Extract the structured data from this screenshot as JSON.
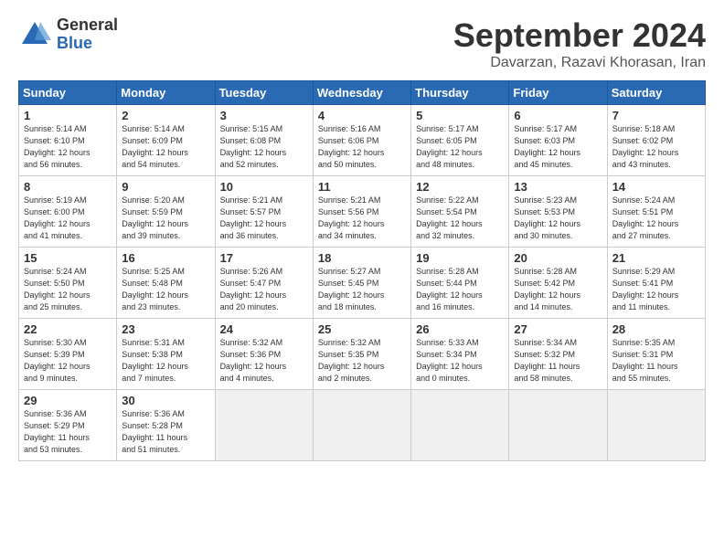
{
  "logo": {
    "general": "General",
    "blue": "Blue"
  },
  "title": "September 2024",
  "location": "Davarzan, Razavi Khorasan, Iran",
  "weekdays": [
    "Sunday",
    "Monday",
    "Tuesday",
    "Wednesday",
    "Thursday",
    "Friday",
    "Saturday"
  ],
  "days": [
    {
      "num": "",
      "info": ""
    },
    {
      "num": "",
      "info": ""
    },
    {
      "num": "",
      "info": ""
    },
    {
      "num": "",
      "info": ""
    },
    {
      "num": "",
      "info": ""
    },
    {
      "num": "",
      "info": ""
    },
    {
      "num": "1",
      "info": "Sunrise: 5:14 AM\nSunset: 6:10 PM\nDaylight: 12 hours\nand 56 minutes."
    },
    {
      "num": "2",
      "info": "Sunrise: 5:14 AM\nSunset: 6:09 PM\nDaylight: 12 hours\nand 54 minutes."
    },
    {
      "num": "3",
      "info": "Sunrise: 5:15 AM\nSunset: 6:08 PM\nDaylight: 12 hours\nand 52 minutes."
    },
    {
      "num": "4",
      "info": "Sunrise: 5:16 AM\nSunset: 6:06 PM\nDaylight: 12 hours\nand 50 minutes."
    },
    {
      "num": "5",
      "info": "Sunrise: 5:17 AM\nSunset: 6:05 PM\nDaylight: 12 hours\nand 48 minutes."
    },
    {
      "num": "6",
      "info": "Sunrise: 5:17 AM\nSunset: 6:03 PM\nDaylight: 12 hours\nand 45 minutes."
    },
    {
      "num": "7",
      "info": "Sunrise: 5:18 AM\nSunset: 6:02 PM\nDaylight: 12 hours\nand 43 minutes."
    },
    {
      "num": "8",
      "info": "Sunrise: 5:19 AM\nSunset: 6:00 PM\nDaylight: 12 hours\nand 41 minutes."
    },
    {
      "num": "9",
      "info": "Sunrise: 5:20 AM\nSunset: 5:59 PM\nDaylight: 12 hours\nand 39 minutes."
    },
    {
      "num": "10",
      "info": "Sunrise: 5:21 AM\nSunset: 5:57 PM\nDaylight: 12 hours\nand 36 minutes."
    },
    {
      "num": "11",
      "info": "Sunrise: 5:21 AM\nSunset: 5:56 PM\nDaylight: 12 hours\nand 34 minutes."
    },
    {
      "num": "12",
      "info": "Sunrise: 5:22 AM\nSunset: 5:54 PM\nDaylight: 12 hours\nand 32 minutes."
    },
    {
      "num": "13",
      "info": "Sunrise: 5:23 AM\nSunset: 5:53 PM\nDaylight: 12 hours\nand 30 minutes."
    },
    {
      "num": "14",
      "info": "Sunrise: 5:24 AM\nSunset: 5:51 PM\nDaylight: 12 hours\nand 27 minutes."
    },
    {
      "num": "15",
      "info": "Sunrise: 5:24 AM\nSunset: 5:50 PM\nDaylight: 12 hours\nand 25 minutes."
    },
    {
      "num": "16",
      "info": "Sunrise: 5:25 AM\nSunset: 5:48 PM\nDaylight: 12 hours\nand 23 minutes."
    },
    {
      "num": "17",
      "info": "Sunrise: 5:26 AM\nSunset: 5:47 PM\nDaylight: 12 hours\nand 20 minutes."
    },
    {
      "num": "18",
      "info": "Sunrise: 5:27 AM\nSunset: 5:45 PM\nDaylight: 12 hours\nand 18 minutes."
    },
    {
      "num": "19",
      "info": "Sunrise: 5:28 AM\nSunset: 5:44 PM\nDaylight: 12 hours\nand 16 minutes."
    },
    {
      "num": "20",
      "info": "Sunrise: 5:28 AM\nSunset: 5:42 PM\nDaylight: 12 hours\nand 14 minutes."
    },
    {
      "num": "21",
      "info": "Sunrise: 5:29 AM\nSunset: 5:41 PM\nDaylight: 12 hours\nand 11 minutes."
    },
    {
      "num": "22",
      "info": "Sunrise: 5:30 AM\nSunset: 5:39 PM\nDaylight: 12 hours\nand 9 minutes."
    },
    {
      "num": "23",
      "info": "Sunrise: 5:31 AM\nSunset: 5:38 PM\nDaylight: 12 hours\nand 7 minutes."
    },
    {
      "num": "24",
      "info": "Sunrise: 5:32 AM\nSunset: 5:36 PM\nDaylight: 12 hours\nand 4 minutes."
    },
    {
      "num": "25",
      "info": "Sunrise: 5:32 AM\nSunset: 5:35 PM\nDaylight: 12 hours\nand 2 minutes."
    },
    {
      "num": "26",
      "info": "Sunrise: 5:33 AM\nSunset: 5:34 PM\nDaylight: 12 hours\nand 0 minutes."
    },
    {
      "num": "27",
      "info": "Sunrise: 5:34 AM\nSunset: 5:32 PM\nDaylight: 11 hours\nand 58 minutes."
    },
    {
      "num": "28",
      "info": "Sunrise: 5:35 AM\nSunset: 5:31 PM\nDaylight: 11 hours\nand 55 minutes."
    },
    {
      "num": "29",
      "info": "Sunrise: 5:36 AM\nSunset: 5:29 PM\nDaylight: 11 hours\nand 53 minutes."
    },
    {
      "num": "30",
      "info": "Sunrise: 5:36 AM\nSunset: 5:28 PM\nDaylight: 11 hours\nand 51 minutes."
    },
    {
      "num": "",
      "info": ""
    },
    {
      "num": "",
      "info": ""
    },
    {
      "num": "",
      "info": ""
    },
    {
      "num": "",
      "info": ""
    },
    {
      "num": "",
      "info": ""
    }
  ]
}
